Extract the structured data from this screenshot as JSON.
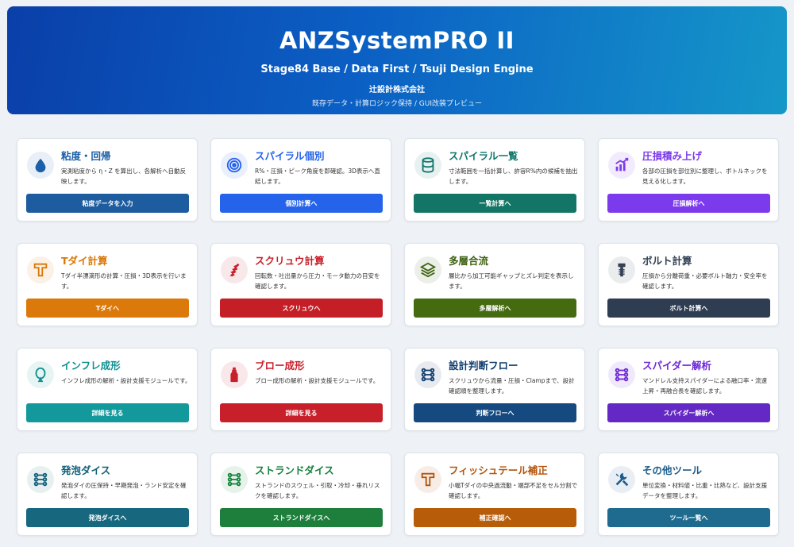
{
  "hero": {
    "title": "ANZSystemPRO II",
    "subtitle": "Stage84 Base / Data First / Tsuji Design Engine",
    "company": "辻設計株式会社",
    "note": "既存データ・計算ロジック保持 / GUI改装プレビュー"
  },
  "cards": [
    {
      "title": "粘度・回帰",
      "desc": "実測粘度から η・Z を算出し、各解析へ自動反映します。",
      "button": "粘度データを入力",
      "icon": "droplet-icon",
      "accent": "#1b5fa8",
      "button_color": "#1d5c9f"
    },
    {
      "title": "スパイラル個別",
      "desc": "R%・圧損・ピーク角度を即確認。3D表示へ直結します。",
      "button": "個別計算へ",
      "icon": "target-icon",
      "accent": "#2563eb",
      "button_color": "#2563eb"
    },
    {
      "title": "スパイラル一覧",
      "desc": "寸法範囲を一括計算し、許容R%内の候補を抽出します。",
      "button": "一覧計算へ",
      "icon": "database-icon",
      "accent": "#0f766e",
      "button_color": "#127566"
    },
    {
      "title": "圧損積み上げ",
      "desc": "各部の圧損を部位別に整理し、ボトルネックを見える化します。",
      "button": "圧損解析へ",
      "icon": "chart-up-icon",
      "accent": "#7c3aed",
      "button_color": "#7c3aed"
    },
    {
      "title": "Tダイ計算",
      "desc": "Tダイ半漂滴形の計算・圧損・3D表示を行います。",
      "button": "Tダイへ",
      "icon": "t-die-icon",
      "accent": "#d97706",
      "button_color": "#db7a0a"
    },
    {
      "title": "スクリュウ計算",
      "desc": "回転数・吐出量から圧力・モータ動力の目安を確認します。",
      "button": "スクリュウへ",
      "icon": "screw-icon",
      "accent": "#c8202a",
      "button_color": "#c41f26"
    },
    {
      "title": "多層合流",
      "desc": "層比から加工可能ギャップとズレ判定を表示します。",
      "button": "多層解析へ",
      "icon": "layers-icon",
      "accent": "#3f6212",
      "button_color": "#456b10"
    },
    {
      "title": "ボルト計算",
      "desc": "圧損から分離荷重・必要ボルト軸力・安全率を確認します。",
      "button": "ボルト計算へ",
      "icon": "bolt-icon",
      "accent": "#334155",
      "button_color": "#2f3d52"
    },
    {
      "title": "インフレ成形",
      "desc": "インフレ成形の解析・設計支援モジュールです。",
      "button": "詳細を見る",
      "icon": "balloon-icon",
      "accent": "#0e8f90",
      "button_color": "#13999b"
    },
    {
      "title": "ブロー成形",
      "desc": "ブロー成形の解析・設計支援モジュールです。",
      "button": "詳細を見る",
      "icon": "bottle-icon",
      "accent": "#c8202a",
      "button_color": "#c8202a"
    },
    {
      "title": "設計判断フロー",
      "desc": "スクリュウから流量・圧損・Clampまで、設計確認順を整理します。",
      "button": "判断フローへ",
      "icon": "flow-icon",
      "accent": "#0f3d6e",
      "button_color": "#144a80"
    },
    {
      "title": "スパイダー解析",
      "desc": "マンドレル支持スパイダーによる融口率・流速上昇・再融合長を確認します。",
      "button": "スパイダー解析へ",
      "icon": "spider-icon",
      "accent": "#6d28d9",
      "button_color": "#6429c4"
    },
    {
      "title": "発泡ダイス",
      "desc": "発泡ダイの圧保持・早期発泡・ランド安定を確認します。",
      "button": "発泡ダイスへ",
      "icon": "foam-icon",
      "accent": "#0f5f7a",
      "button_color": "#17677f"
    },
    {
      "title": "ストランドダイス",
      "desc": "ストランドのスウェル・引取・冷却・垂れリスクを確認します。",
      "button": "ストランドダイスへ",
      "icon": "strand-icon",
      "accent": "#15803d",
      "button_color": "#1d7f3b"
    },
    {
      "title": "フィッシュテール補正",
      "desc": "小幅Tダイの中央過流動・端部不足をセル分割で確認します。",
      "button": "補正確認へ",
      "icon": "fishtail-icon",
      "accent": "#b45309",
      "button_color": "#b75c08"
    },
    {
      "title": "その他ツール",
      "desc": "単位変換・材料値・比重・比熱など、設計支援データを整理します。",
      "button": "ツール一覧へ",
      "icon": "tools-icon",
      "accent": "#1d5c8c",
      "button_color": "#1e6b8f"
    }
  ]
}
